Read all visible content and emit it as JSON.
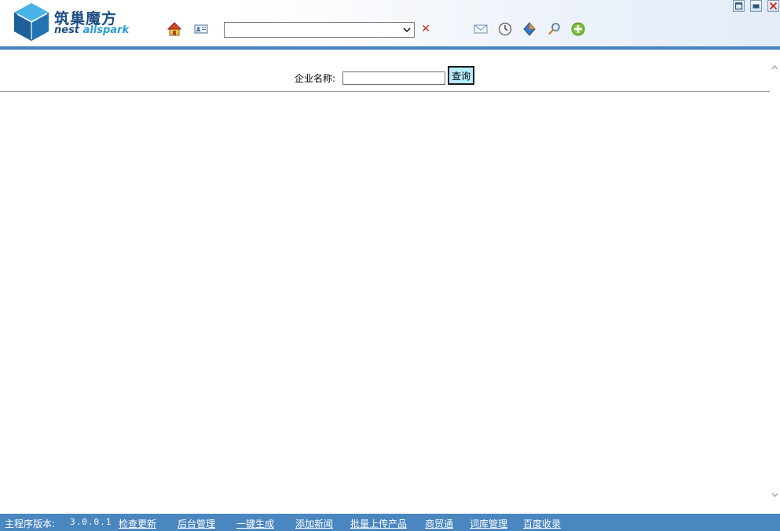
{
  "logo": {
    "name_cn": "筑巢魔方",
    "name_en_part1": "nest ",
    "name_en_part2": "allspark"
  },
  "toolbar": {
    "icons": [
      "home-icon",
      "contact-card-icon",
      "message-icon",
      "history-clock-icon",
      "diamond-icon",
      "search-magnifier-icon",
      "add-plus-icon"
    ],
    "address_select_value": "",
    "clear_symbol": "✕"
  },
  "window_controls": [
    "restore-icon",
    "minimize-icon",
    "close-icon"
  ],
  "search": {
    "label": "企业名称:",
    "input_value": "",
    "button_label": "查询"
  },
  "statusbar": {
    "version_label": "主程序版本:",
    "version_value": "3.0.0.1",
    "links": [
      "检查更新",
      "后台管理",
      "一键生成",
      "添加新闻",
      "批量上传产品",
      "商贸通",
      "词库管理",
      "百度收录"
    ]
  },
  "colors": {
    "brand_blue": "#4a86c0",
    "button_fill": "#b6ecff",
    "clear_red": "#c8231b"
  }
}
